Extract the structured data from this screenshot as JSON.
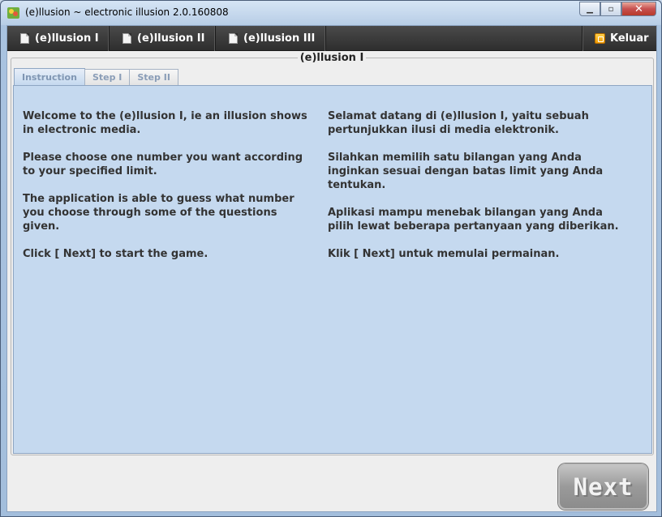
{
  "window": {
    "title": "(e)llusion ~ electronic illusion 2.0.160808",
    "minimize_icon": "minimize-icon",
    "maximize_icon": "maximize-icon",
    "close_icon": "close-icon"
  },
  "menu": {
    "items": [
      {
        "label": "(e)llusion I",
        "icon": "document-icon"
      },
      {
        "label": "(e)llusion II",
        "icon": "document-icon"
      },
      {
        "label": "(e)llusion III",
        "icon": "document-icon"
      }
    ],
    "exit_label": "Keluar",
    "exit_icon": "exit-icon"
  },
  "group": {
    "title": "(e)llusion I"
  },
  "tabs": [
    {
      "label": "Instruction",
      "active": true
    },
    {
      "label": "Step I",
      "active": false
    },
    {
      "label": "Step II",
      "active": false
    }
  ],
  "instructions": {
    "english": [
      "Welcome to the (e)llusion I, ie an illusion shows in electronic media.",
      "Please choose one number you want according to your specified limit.",
      "The application is able to guess what number you choose through some of the questions given.",
      "Click [ Next] to start the game."
    ],
    "indonesian": [
      "Selamat datang di (e)llusion I, yaitu sebuah pertunjukkan ilusi di media elektronik.",
      "Silahkan memilih satu bilangan yang Anda inginkan sesuai dengan batas limit yang Anda tentukan.",
      "Aplikasi mampu menebak bilangan yang Anda pilih lewat beberapa pertanyaan yang diberikan.",
      "Klik [ Next] untuk memulai permainan."
    ]
  },
  "next_button": {
    "label": "Next"
  }
}
